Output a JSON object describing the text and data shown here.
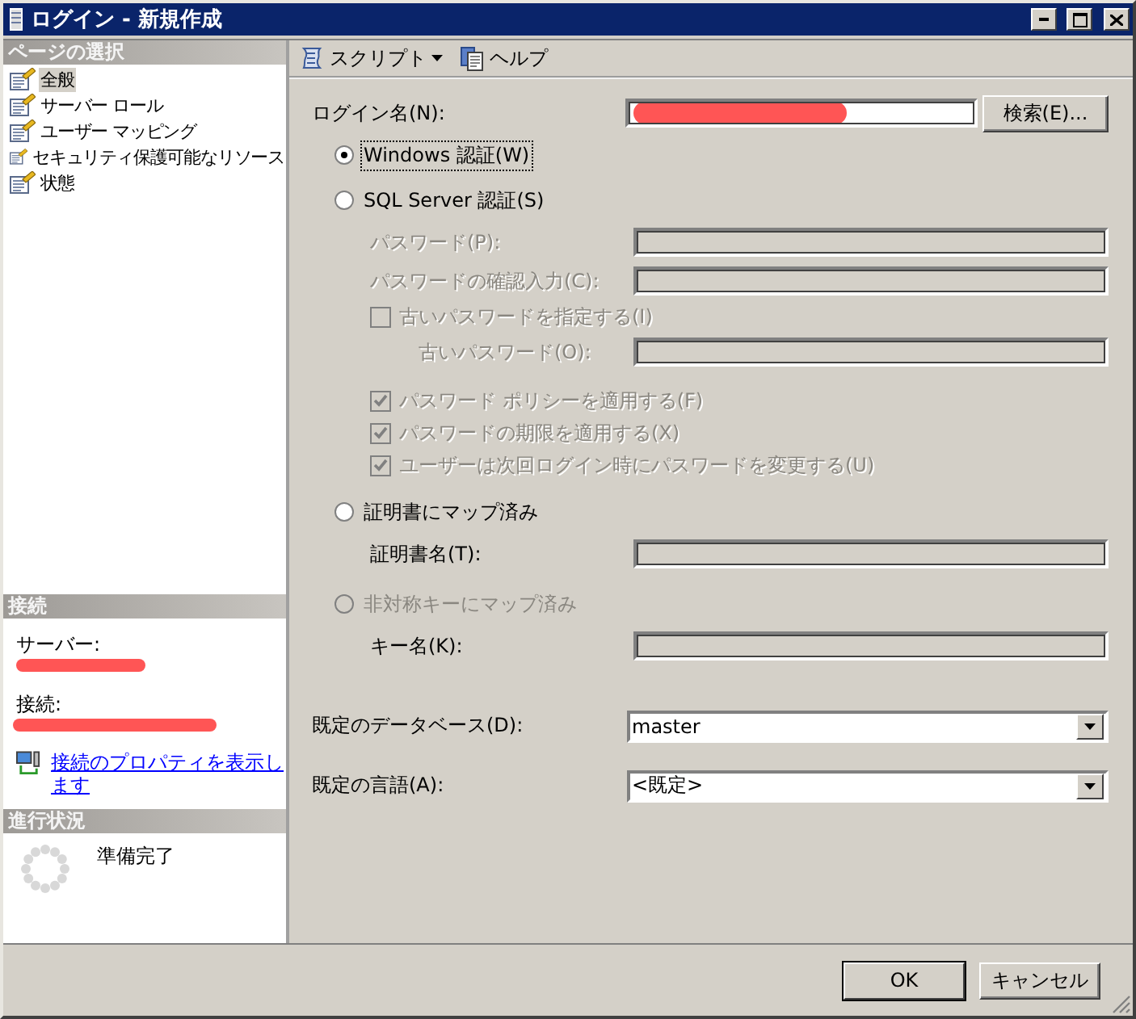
{
  "window": {
    "title": "ログイン - 新規作成"
  },
  "sidebar": {
    "pages_header": "ページの選択",
    "pages": [
      {
        "label": "全般",
        "selected": true
      },
      {
        "label": "サーバー ロール",
        "selected": false
      },
      {
        "label": "ユーザー マッピング",
        "selected": false
      },
      {
        "label": "セキュリティ保護可能なリソース",
        "selected": false
      },
      {
        "label": "状態",
        "selected": false
      }
    ],
    "connection_header": "接続",
    "server": {
      "label": "サーバー:",
      "redacted": true
    },
    "connection": {
      "label": "接続:",
      "redacted": true
    },
    "properties_link": "接続のプロパティを表示します",
    "progress_header": "進行状況",
    "progress_status": "準備完了"
  },
  "toolbar": [
    {
      "kind": "dropdown",
      "label": "スクリプト"
    },
    {
      "kind": "button",
      "label": "ヘルプ"
    }
  ],
  "login": {
    "label": "ログイン名(N):",
    "redacted": true,
    "button": "検索(E)..."
  },
  "auth_options": [
    {
      "label": "Windows 認証(W)",
      "selected": true,
      "disabled": false,
      "focused": true
    },
    {
      "label": "SQL Server 認証(S)",
      "selected": false,
      "disabled": false,
      "focused": false,
      "children": [
        {
          "kind": "field",
          "label": "パスワード(P):",
          "label_greyed": true,
          "disabled": true
        },
        {
          "kind": "field",
          "label": "パスワードの確認入力(C):",
          "label_greyed": true,
          "disabled": true
        },
        {
          "kind": "checkbox",
          "label": "古いパスワードを指定する(I)",
          "checked": false,
          "disabled": true,
          "children": [
            {
              "kind": "field",
              "label": "古いパスワード(O):",
              "label_greyed": true,
              "disabled": true
            }
          ]
        },
        {
          "kind": "checkbox",
          "label": "パスワード ポリシーを適用する(F)",
          "checked": true,
          "disabled": true
        },
        {
          "kind": "checkbox",
          "label": "パスワードの期限を適用する(X)",
          "checked": true,
          "disabled": true
        },
        {
          "kind": "checkbox",
          "label": "ユーザーは次回ログイン時にパスワードを変更する(U)",
          "checked": true,
          "disabled": true
        }
      ]
    },
    {
      "label": "証明書にマップ済み",
      "selected": false,
      "disabled": false,
      "focused": false,
      "children": [
        {
          "kind": "field",
          "label": "証明書名(T):",
          "label_greyed": false,
          "disabled": true
        }
      ]
    },
    {
      "label": "非対称キーにマップ済み",
      "selected": false,
      "disabled": true,
      "focused": false,
      "children": [
        {
          "kind": "field",
          "label": "キー名(K):",
          "label_greyed": false,
          "disabled": true
        }
      ]
    }
  ],
  "defaults": [
    {
      "label": "既定のデータベース(D):",
      "value": "master"
    },
    {
      "label": "既定の言語(A):",
      "value": "<既定>"
    }
  ],
  "footer_buttons": [
    {
      "label": "OK",
      "default": true
    },
    {
      "label": "キャンセル",
      "default": false
    }
  ]
}
